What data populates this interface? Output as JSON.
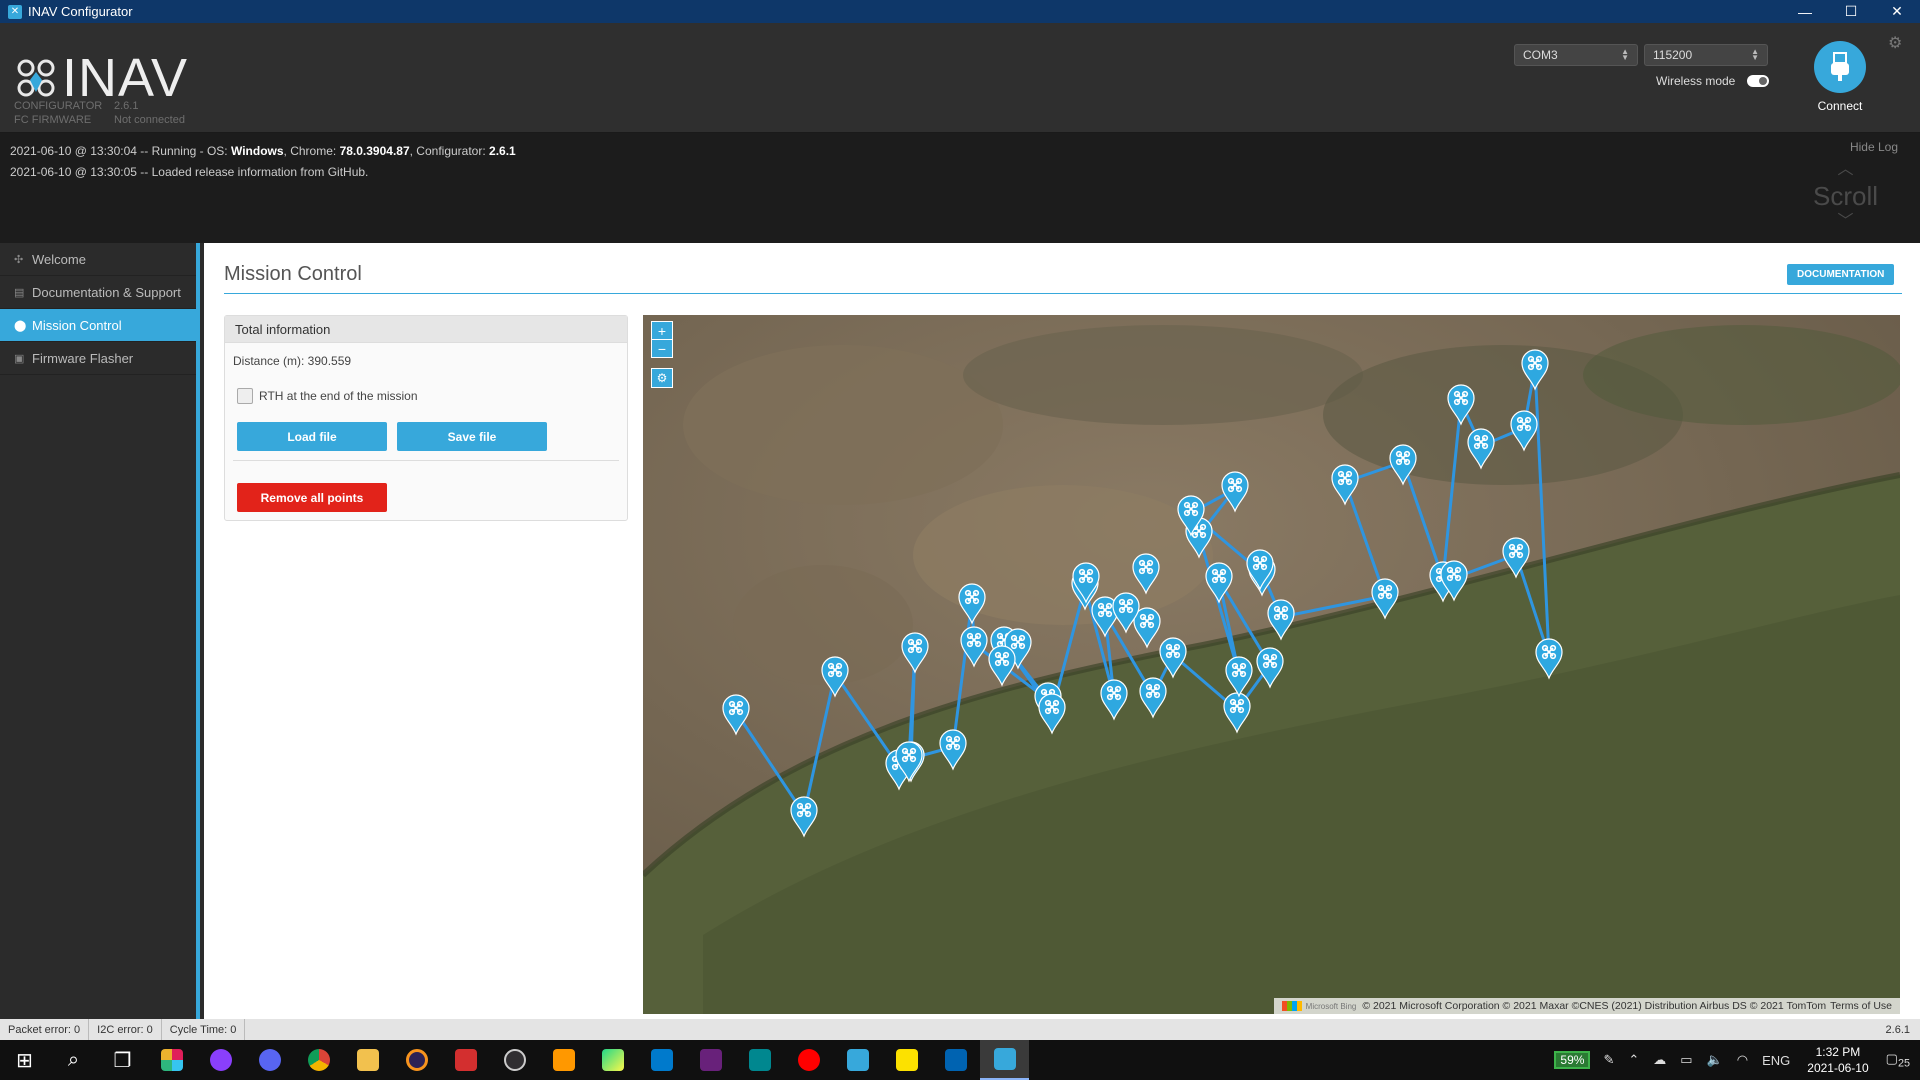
{
  "window": {
    "title": "INAV Configurator"
  },
  "header": {
    "brand": "INAV",
    "configurator_label": "CONFIGURATOR",
    "configurator_version": "2.6.1",
    "fc_label": "FC FIRMWARE",
    "fc_status": "Not connected",
    "port": "COM3",
    "baud": "115200",
    "wireless_label": "Wireless mode",
    "connect_label": "Connect"
  },
  "log": {
    "hide_label": "Hide Log",
    "scroll_label": "Scroll",
    "lines": [
      {
        "prefix": "2021-06-10 @ 13:30:04 -- Running - OS: ",
        "os": "Windows",
        "mid1": ", Chrome: ",
        "chrome": "78.0.3904.87",
        "mid2": ", Configurator: ",
        "cfg": "2.6.1"
      },
      {
        "text": "2021-06-10 @ 13:30:05 -- Loaded release information from GitHub."
      }
    ]
  },
  "sidebar": {
    "items": [
      {
        "label": "Welcome",
        "icon": "welcome-icon"
      },
      {
        "label": "Documentation & Support",
        "icon": "documentation-icon"
      },
      {
        "label": "Mission Control",
        "icon": "map-marker-icon"
      },
      {
        "label": "Firmware Flasher",
        "icon": "chip-icon"
      }
    ]
  },
  "main": {
    "title": "Mission Control",
    "doc_button": "DOCUMENTATION",
    "panel": {
      "header": "Total information",
      "distance": "Distance (m): 390.559",
      "rth_label": "RTH at the end of the mission",
      "rth_checked": false,
      "load": "Load file",
      "save": "Save file",
      "remove": "Remove all points"
    },
    "map": {
      "zoom_in": "+",
      "zoom_out": "−",
      "attribution_bing": "Microsoft Bing",
      "attribution": "© 2021 Microsoft Corporation © 2021 Maxar ©CNES (2021) Distribution Airbus DS © 2021 TomTom",
      "terms": "Terms of Use"
    }
  },
  "status": {
    "packet_error": "Packet error: 0",
    "i2c_error": "I2C error: 0",
    "cycle_time": "Cycle Time: 0",
    "version": "2.6.1"
  },
  "taskbar": {
    "battery": "59%",
    "lang": "ENG",
    "time": "1:32 PM",
    "date": "2021-06-10",
    "notif_count": "25"
  },
  "colors": {
    "accent": "#37a8db",
    "danger": "#e2231a",
    "route": "#2f95e0"
  }
}
